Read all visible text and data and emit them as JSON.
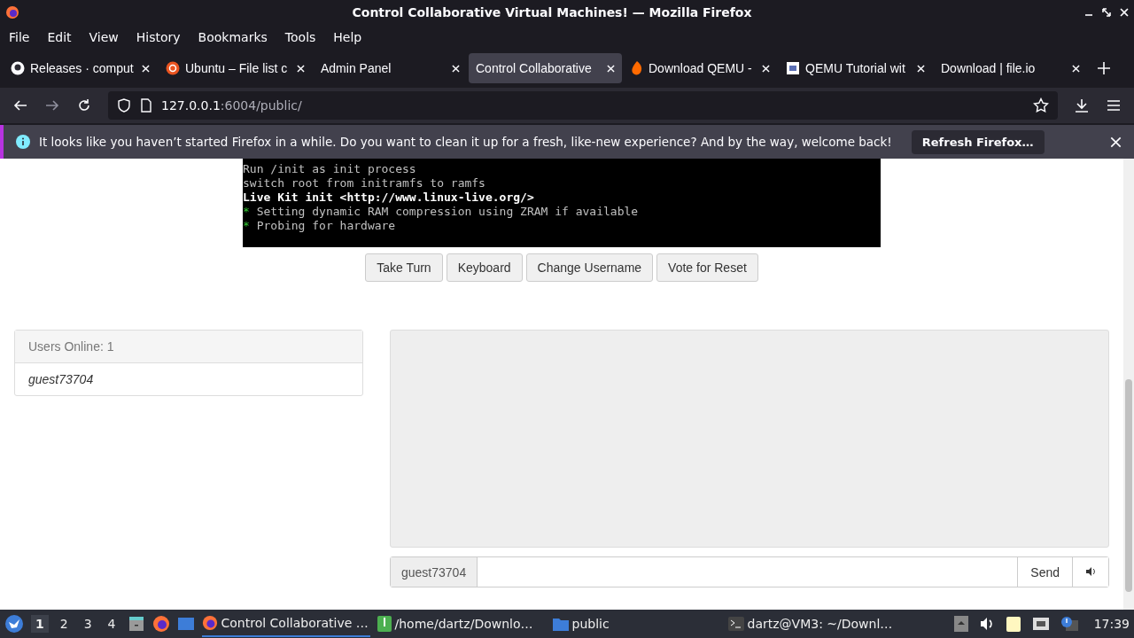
{
  "window": {
    "title": "Control Collaborative Virtual Machines! — Mozilla Firefox"
  },
  "menu": [
    "File",
    "Edit",
    "View",
    "History",
    "Bookmarks",
    "Tools",
    "Help"
  ],
  "tabs": [
    {
      "label": "Releases · comput",
      "selected": false
    },
    {
      "label": "Ubuntu – File list c",
      "selected": false
    },
    {
      "label": "Admin Panel",
      "selected": false
    },
    {
      "label": "Control Collaborative",
      "selected": true
    },
    {
      "label": "Download QEMU -",
      "selected": false
    },
    {
      "label": "QEMU Tutorial wit",
      "selected": false
    },
    {
      "label": "Download | file.io",
      "selected": false
    }
  ],
  "address": {
    "host": "127.0.0.1",
    "path": ":6004/public/"
  },
  "notification": {
    "message": "It looks like you haven’t started Firefox in a while. Do you want to clean it up for a fresh, like-new experience? And by the way, welcome back!",
    "button": "Refresh Firefox…"
  },
  "console_lines": [
    {
      "text": "Run /init as init process",
      "kind": "plain"
    },
    {
      "text": "switch root from initramfs to ramfs",
      "kind": "plain"
    },
    {
      "text": "Live Kit init <http://www.linux-live.org/>",
      "kind": "bright"
    },
    {
      "text": "Setting dynamic RAM compression using ZRAM if available",
      "kind": "star",
      "marker": "*"
    },
    {
      "text": "Probing for hardware",
      "kind": "star",
      "marker": "*"
    }
  ],
  "vm_buttons": [
    "Take Turn",
    "Keyboard",
    "Change Username",
    "Vote for Reset"
  ],
  "users_panel": {
    "heading": "Users Online: 1",
    "users": [
      "guest73704"
    ]
  },
  "chat": {
    "username": "guest73704",
    "send": "Send"
  },
  "taskbar": {
    "workspaces": [
      {
        "label": "1",
        "selected": true
      },
      {
        "label": "2",
        "selected": false
      },
      {
        "label": "3",
        "selected": false
      },
      {
        "label": "4",
        "selected": false
      }
    ],
    "windows": [
      {
        "label": "Control Collaborative …",
        "selected": true
      },
      {
        "label": "/home/dartz/Downlo…",
        "selected": false
      },
      {
        "label": "public",
        "selected": false
      },
      {
        "label": "dartz@VM3: ~/Downl…",
        "selected": false
      }
    ],
    "clock": "17:39"
  }
}
